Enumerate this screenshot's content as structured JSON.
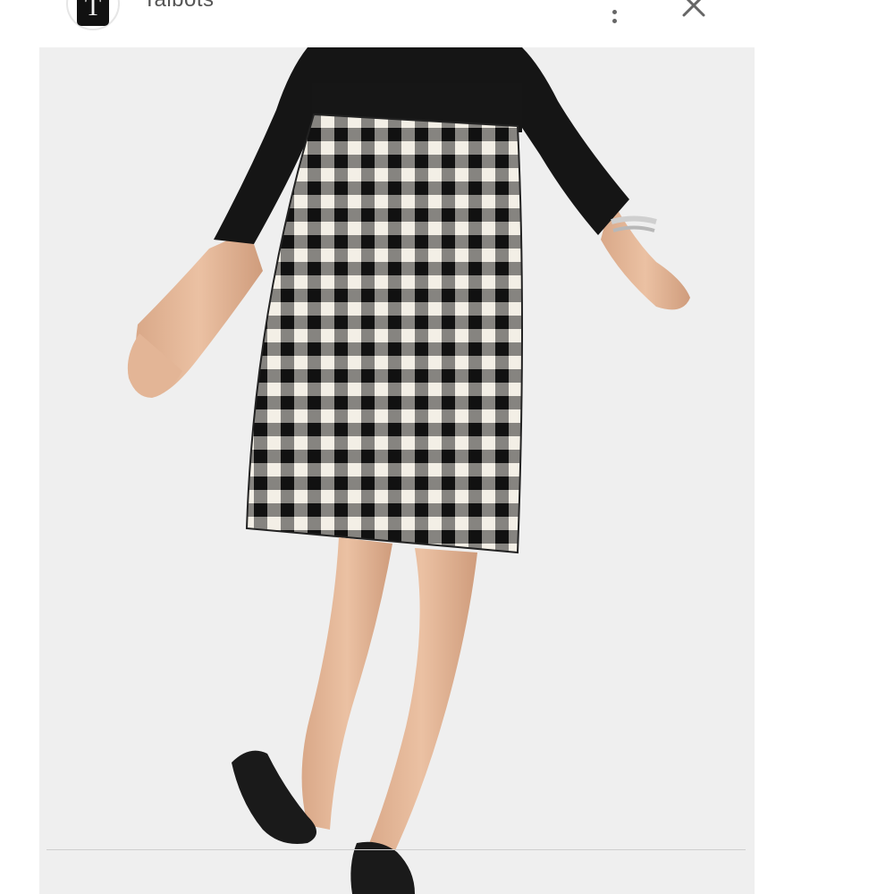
{
  "header": {
    "site_name": "Talbots",
    "site_icon_letter": "T",
    "more_icon": "more-vertical-icon",
    "close_icon": "close-icon"
  },
  "product_image": {
    "description_icon": "product-photo"
  },
  "colors": {
    "background": "#ffffff",
    "image_bg": "#efefef",
    "header_text": "#555555",
    "icon": "#666666"
  }
}
